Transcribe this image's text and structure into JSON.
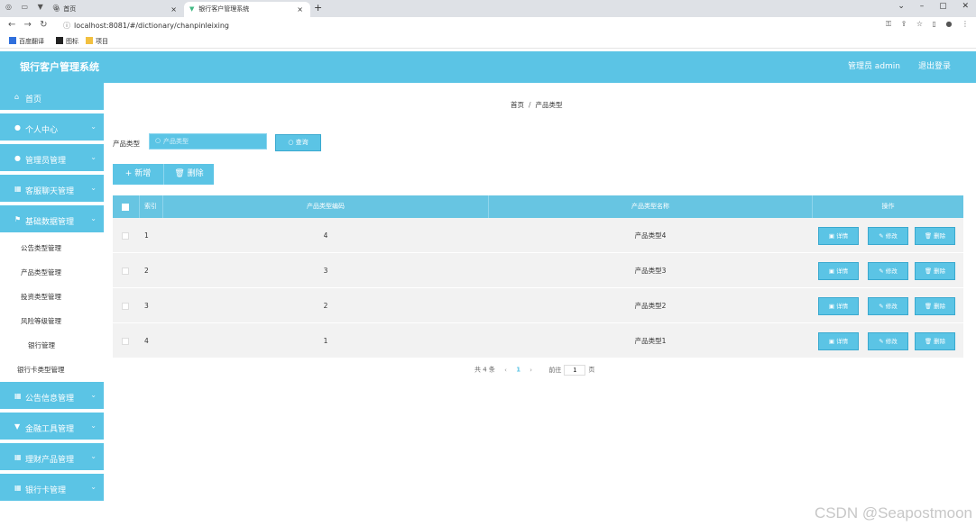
{
  "browser": {
    "tabs": [
      {
        "label": "首页",
        "active": false
      },
      {
        "label": "银行客户管理系统",
        "active": true
      }
    ],
    "url": "localhost:8081/#/dictionary/chanpinleixing",
    "bookmarks": [
      "百度翻译",
      "图标",
      "项目"
    ]
  },
  "header": {
    "title": "银行客户管理系统",
    "user": "管理员 admin",
    "logout": "退出登录"
  },
  "sidebar": {
    "items": [
      {
        "label": "首页",
        "icon": "home-icon"
      },
      {
        "label": "个人中心",
        "icon": "user-icon"
      },
      {
        "label": "管理员管理",
        "icon": "user-icon"
      },
      {
        "label": "客服聊天管理",
        "icon": "grid-icon"
      },
      {
        "label": "基础数据管理",
        "icon": "flag-icon"
      }
    ],
    "submenu": [
      "公告类型管理",
      "产品类型管理",
      "投资类型管理",
      "风险等级管理",
      "银行管理",
      "银行卡类型管理"
    ],
    "items_after": [
      {
        "label": "公告信息管理",
        "icon": "grid-icon"
      },
      {
        "label": "金融工具管理",
        "icon": "filter-icon"
      },
      {
        "label": "理财产品管理",
        "icon": "grid-icon"
      },
      {
        "label": "银行卡管理",
        "icon": "grid-icon"
      }
    ]
  },
  "breadcrumb": {
    "home": "首页",
    "current": "产品类型"
  },
  "search": {
    "label": "产品类型",
    "placeholder": "产品类型",
    "button": "查询"
  },
  "actions": {
    "add": "+ 新增",
    "delete": "删除"
  },
  "table": {
    "headers": {
      "index": "索引",
      "code": "产品类型编码",
      "name": "产品类型名称",
      "ops": "操作"
    },
    "rows": [
      {
        "index": "1",
        "code": "4",
        "name": "产品类型4"
      },
      {
        "index": "2",
        "code": "3",
        "name": "产品类型3"
      },
      {
        "index": "3",
        "code": "2",
        "name": "产品类型2"
      },
      {
        "index": "4",
        "code": "1",
        "name": "产品类型1"
      }
    ],
    "row_buttons": {
      "detail": "详情",
      "edit": "修改",
      "delete": "删除"
    }
  },
  "pagination": {
    "total": "共 4 条",
    "current": "1",
    "goto_label": "前往",
    "goto_value": "1",
    "page_suffix": "页"
  },
  "watermark": "CSDN @Seapostmoon",
  "colors": {
    "accent": "#5bc4e5",
    "table_header": "#67c5e2",
    "row_bg": "#f2f2f2"
  }
}
